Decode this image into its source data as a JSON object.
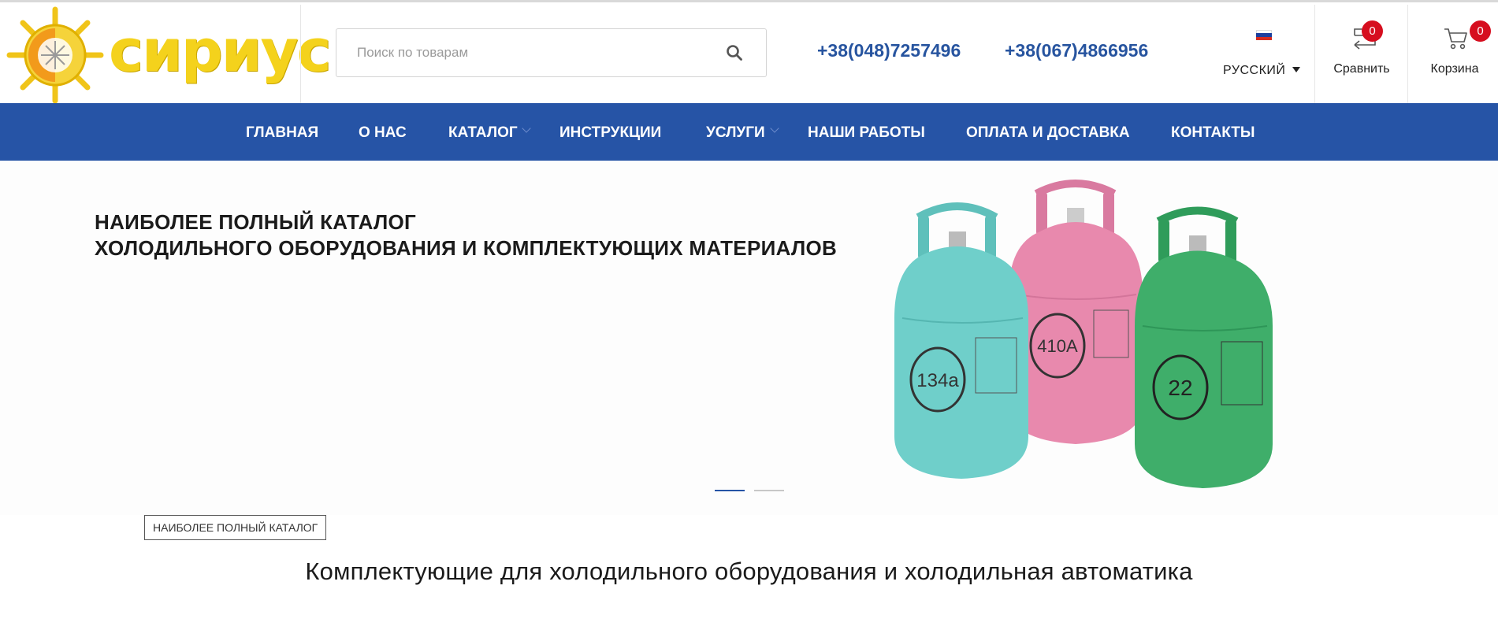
{
  "brand": {
    "name": "сириус",
    "logo_color": "#f4d21c"
  },
  "search": {
    "placeholder": "Поиск по товарам",
    "icon": "search-icon"
  },
  "phones": [
    "+38(048)7257496",
    "+38(067)4866956"
  ],
  "language": {
    "label": "РУССКИЙ",
    "flag": "ru-flag-icon"
  },
  "compare": {
    "label": "Сравнить",
    "count": "0",
    "icon": "compare-icon"
  },
  "cart": {
    "label": "Корзина",
    "count": "0",
    "icon": "cart-icon"
  },
  "nav": {
    "items": [
      {
        "label": "ГЛАВНАЯ"
      },
      {
        "label": "О НАС"
      },
      {
        "label": "КАТАЛОГ",
        "has_submenu": true
      },
      {
        "label": "ИНСТРУКЦИИ"
      },
      {
        "label": "УСЛУГИ",
        "has_submenu": true
      },
      {
        "label": "НАШИ РАБОТЫ"
      },
      {
        "label": "ОПЛАТА И ДОСТАВКА"
      },
      {
        "label": "КОНТАКТЫ"
      }
    ]
  },
  "hero": {
    "line1": "НАИБОЛЕЕ ПОЛНЫЙ КАТАЛОГ",
    "line2": "ХОЛОДИЛЬНОГО ОБОРУДОВАНИЯ И КОМПЛЕКТУЮЩИХ МАТЕРИАЛОВ",
    "cylinders": [
      {
        "label": "134a",
        "color": "#6fcfca"
      },
      {
        "label": "410A",
        "color": "#e889ad"
      },
      {
        "label": "22",
        "color": "#3fae6a"
      }
    ],
    "slides_total": 2,
    "active_slide": 1
  },
  "tag": "НАИБОЛЕЕ ПОЛНЫЙ КАТАЛОГ",
  "section_title": "Комплектующие для холодильного оборудования и холодильная автоматика",
  "colors": {
    "nav_bg": "#2654a6",
    "phone": "#27549f",
    "badge": "#d60e1f"
  }
}
